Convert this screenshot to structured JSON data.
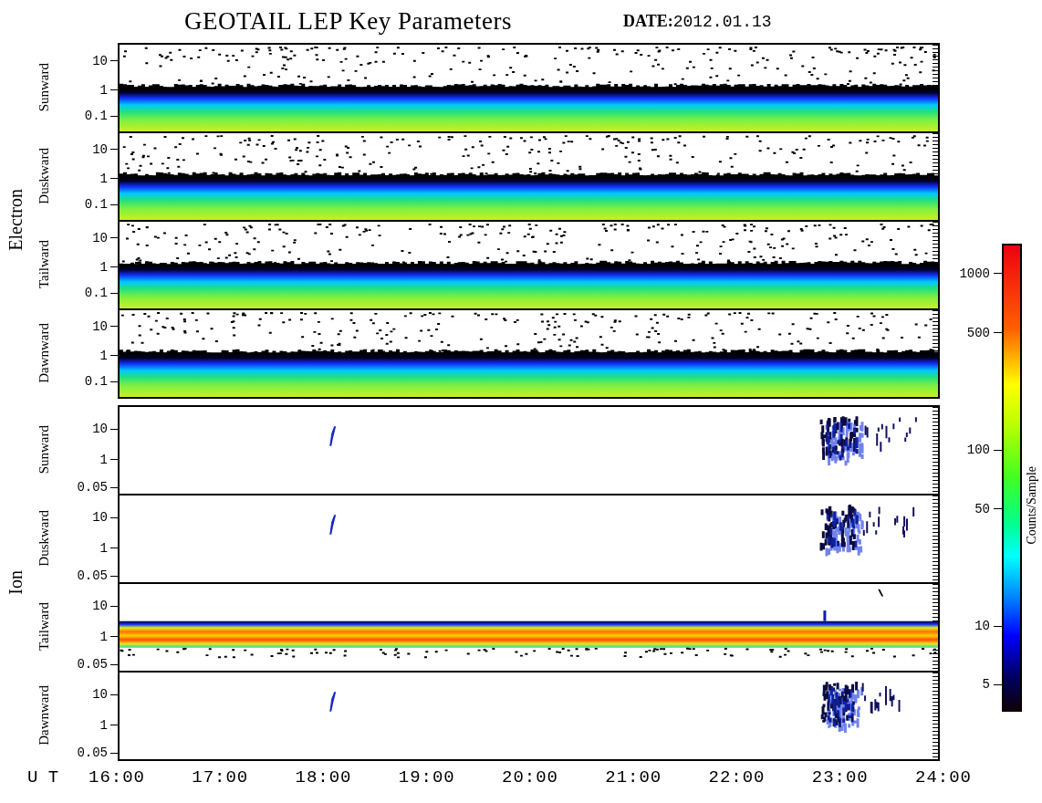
{
  "title": "GEOTAIL LEP Key Parameters",
  "date": {
    "label": "DATE:",
    "value": "2012.01.13"
  },
  "groups": [
    {
      "label": "Electron",
      "panels": [
        {
          "label": "Sunward",
          "kind": "electron",
          "yticks": [
            "10",
            "1",
            "0.1"
          ]
        },
        {
          "label": "Duskward",
          "kind": "electron",
          "yticks": [
            "10",
            "1",
            "0.1"
          ]
        },
        {
          "label": "Tailward",
          "kind": "electron",
          "yticks": [
            "10",
            "1",
            "0.1"
          ]
        },
        {
          "label": "Dawnward",
          "kind": "electron",
          "yticks": [
            "10",
            "1",
            "0.1"
          ]
        }
      ]
    },
    {
      "label": "Ion",
      "panels": [
        {
          "label": "Sunward",
          "kind": "ion-sparse",
          "yticks": [
            "10",
            "1",
            "0.05"
          ]
        },
        {
          "label": "Duskward",
          "kind": "ion-sparse",
          "yticks": [
            "10",
            "1",
            "0.05"
          ]
        },
        {
          "label": "Tailward",
          "kind": "ion-band",
          "yticks": [
            "10",
            "1",
            "0.05"
          ]
        },
        {
          "label": "Dawnward",
          "kind": "ion-sparse",
          "yticks": [
            "10",
            "1",
            "0.05"
          ]
        }
      ]
    }
  ],
  "x_axis": {
    "label": "U T",
    "ticks": [
      "16:00",
      "17:00",
      "18:00",
      "19:00",
      "20:00",
      "21:00",
      "22:00",
      "23:00",
      "24:00"
    ]
  },
  "colorbar": {
    "label": "Counts/Sample",
    "ticks": [
      "1000",
      "500",
      "100",
      "50",
      "10",
      "5"
    ]
  }
}
